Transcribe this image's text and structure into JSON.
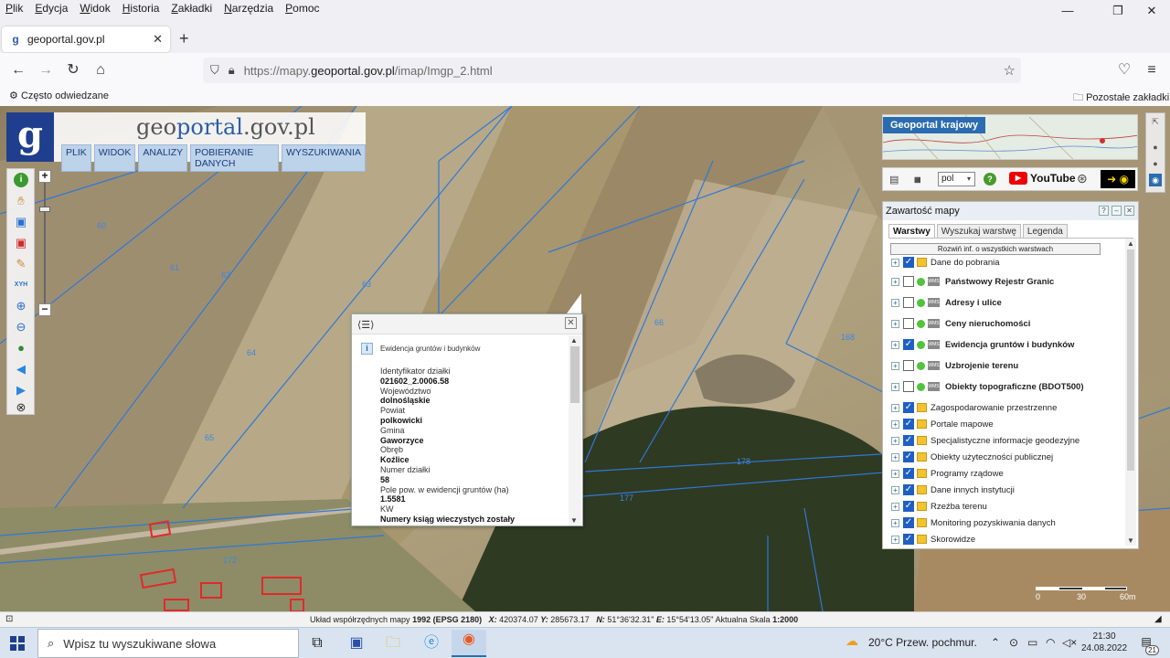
{
  "menubar": {
    "items": [
      {
        "label": "Plik",
        "u": "P",
        "rest": "lik"
      },
      {
        "label": "Edycja",
        "u": "E",
        "rest": "dycja"
      },
      {
        "label": "Widok",
        "u": "W",
        "rest": "idok"
      },
      {
        "label": "Historia",
        "u": "H",
        "rest": "istoria"
      },
      {
        "label": "Zakładki",
        "u": "Z",
        "rest": "akładki"
      },
      {
        "label": "Narzędzia",
        "u": "N",
        "rest": "arzędzia"
      },
      {
        "label": "Pomoc",
        "u": "P",
        "rest": "omoc"
      }
    ]
  },
  "tab": {
    "title": "geoportal.gov.pl",
    "close": "✕",
    "new": "+"
  },
  "nav": {
    "url_prefix": "https://mapy.",
    "url_domain": "geoportal.gov.pl",
    "url_path": "/imap/Imgp_2.html"
  },
  "bookmarks": {
    "frequent": "Często odwiedzane",
    "other": "Pozostałe zakładki"
  },
  "gp": {
    "logo": "g",
    "title_a": "geo",
    "title_b": "portal",
    "title_c": ".gov.pl",
    "menu": [
      "PLIK",
      "WIDOK",
      "ANALIZY",
      "POBIERANIE DANYCH",
      "WYSZUKIWANIA"
    ]
  },
  "map_labels": [
    "60",
    "61",
    "62",
    "63",
    "64",
    "65",
    "66",
    "178",
    "177",
    "172",
    "168"
  ],
  "popup": {
    "layer_title": "Ewidencja gruntów i budynków",
    "fields": [
      {
        "label": "Identyfikator działki",
        "value": "021602_2.0006.58"
      },
      {
        "label": "Województwo",
        "value": "dolnośląskie"
      },
      {
        "label": "Powiat",
        "value": "polkowicki"
      },
      {
        "label": "Gmina",
        "value": "Gaworzyce"
      },
      {
        "label": "Obręb",
        "value": "Koźlice"
      },
      {
        "label": "Numer działki",
        "value": "58"
      },
      {
        "label": "Pole pow. w ewidencji gruntów (ha)",
        "value": "1.5581"
      },
      {
        "label": "KW",
        "value": "Numery ksiąg wieczystych zostały"
      }
    ]
  },
  "gk": {
    "label": "Geoportal krajowy"
  },
  "tools2": {
    "lang": "pol",
    "youtube": "YouTube"
  },
  "layers": {
    "title": "Zawartość mapy",
    "tabs": [
      "Warstwy",
      "Wyszukaj warstwę",
      "Legenda"
    ],
    "expand_all": "Rozwiń inf. o wszystkich warstwach",
    "items": [
      {
        "label": "Dane do pobrania",
        "checked": true,
        "kind": "folder",
        "bold": false
      },
      {
        "label": "Państwowy Rejestr Granic",
        "checked": false,
        "kind": "wms",
        "bold": true
      },
      {
        "label": "Adresy i ulice",
        "checked": false,
        "kind": "wms",
        "bold": true
      },
      {
        "label": "Ceny nieruchomości",
        "checked": false,
        "kind": "wms",
        "bold": true
      },
      {
        "label": "Ewidencja gruntów i budynków",
        "checked": true,
        "kind": "wms",
        "bold": true
      },
      {
        "label": "Uzbrojenie terenu",
        "checked": false,
        "kind": "wms",
        "bold": true
      },
      {
        "label": "Obiekty topograficzne (BDOT500)",
        "checked": false,
        "kind": "wms",
        "bold": true
      },
      {
        "label": "Zagospodarowanie przestrzenne",
        "checked": true,
        "kind": "folder",
        "bold": false
      },
      {
        "label": "Portale mapowe",
        "checked": true,
        "kind": "folder",
        "bold": false
      },
      {
        "label": "Specjalistyczne informacje geodezyjne",
        "checked": true,
        "kind": "folder",
        "bold": false
      },
      {
        "label": "Obiekty użyteczności publicznej",
        "checked": true,
        "kind": "folder",
        "bold": false
      },
      {
        "label": "Programy rządowe",
        "checked": true,
        "kind": "folder",
        "bold": false
      },
      {
        "label": "Dane innych instytucji",
        "checked": true,
        "kind": "folder",
        "bold": false
      },
      {
        "label": "Rzeźba terenu",
        "checked": true,
        "kind": "folder",
        "bold": false
      },
      {
        "label": "Monitoring pozyskiwania danych",
        "checked": true,
        "kind": "folder",
        "bold": false
      },
      {
        "label": "Skorowidze",
        "checked": true,
        "kind": "folder",
        "bold": false
      }
    ]
  },
  "scale": {
    "t0": "0",
    "t1": "30",
    "t2": "60m"
  },
  "coords": {
    "system_label": "Układ współrzędnych mapy",
    "system": "1992 (EPSG 2180)",
    "x_label": "X:",
    "x": "420374.07",
    "y_label": "Y:",
    "y": "285673.17",
    "n_label": "N:",
    "n": "51°36'32.31\"",
    "e_label": "E:",
    "e": "15°54'13.05\"",
    "scale_label": "Aktualna Skala",
    "scale": "1:2000"
  },
  "taskbar": {
    "search_placeholder": "Wpisz tu wyszukiwane słowa",
    "weather": "20°C  Przew. pochmur.",
    "time": "21:30",
    "date": "24.08.2022",
    "notifications": "21"
  }
}
